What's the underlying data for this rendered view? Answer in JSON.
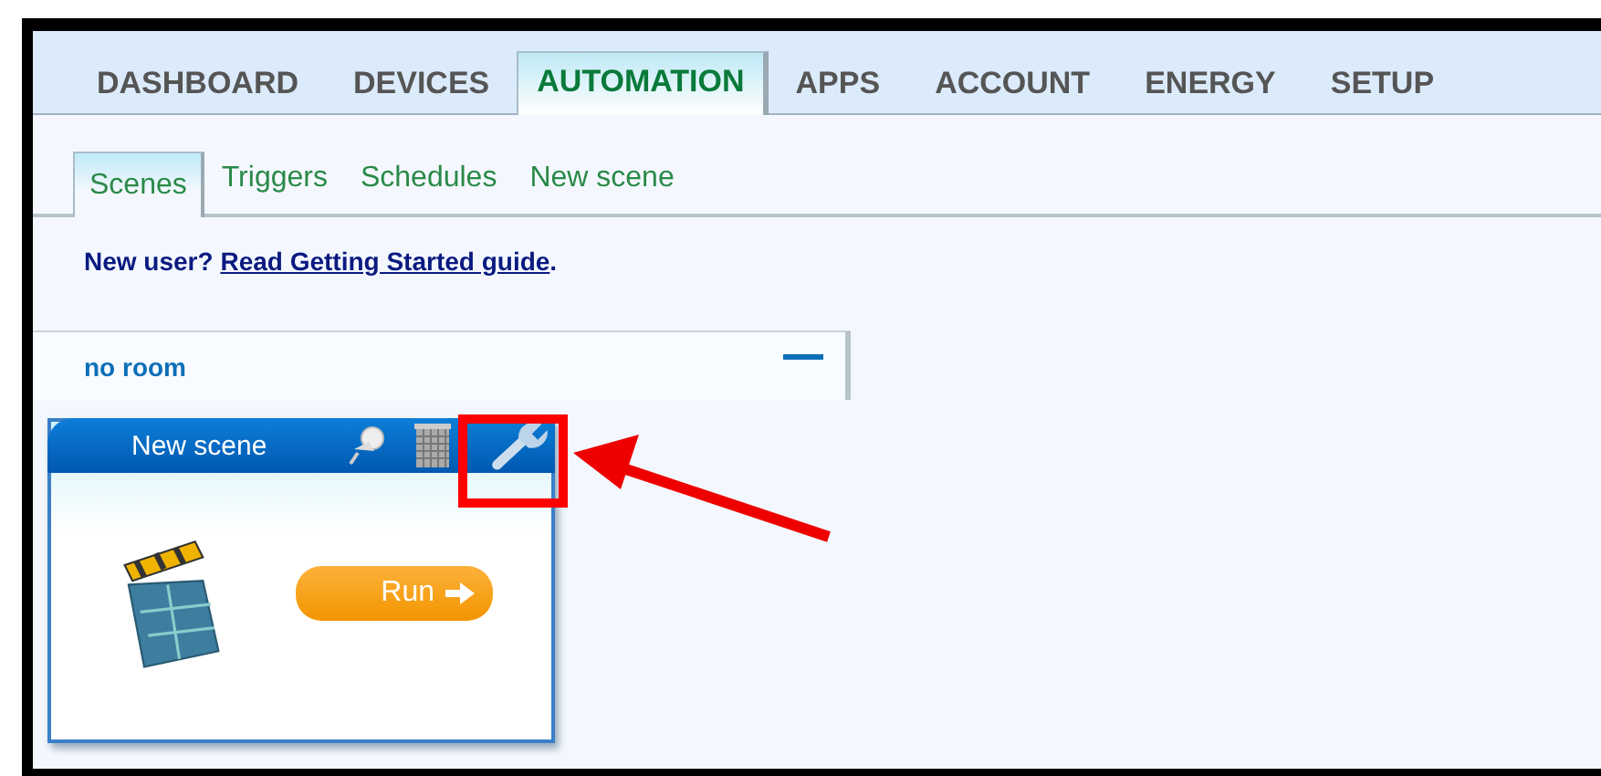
{
  "main_tabs": [
    {
      "label": "DASHBOARD",
      "selected": false
    },
    {
      "label": "DEVICES",
      "selected": false
    },
    {
      "label": "AUTOMATION",
      "selected": true
    },
    {
      "label": "APPS",
      "selected": false
    },
    {
      "label": "ACCOUNT",
      "selected": false
    },
    {
      "label": "ENERGY",
      "selected": false
    },
    {
      "label": "SETUP",
      "selected": false
    }
  ],
  "sub_tabs": [
    {
      "label": "Scenes",
      "selected": true
    },
    {
      "label": "Triggers",
      "selected": false
    },
    {
      "label": "Schedules",
      "selected": false
    },
    {
      "label": "New scene",
      "selected": false
    }
  ],
  "notice": {
    "text": "New user?",
    "link": "Read Getting Started guide",
    "end": "."
  },
  "room": {
    "title": "no room",
    "expanded": true
  },
  "scene_card": {
    "title": "New scene",
    "run_button": "Run"
  }
}
